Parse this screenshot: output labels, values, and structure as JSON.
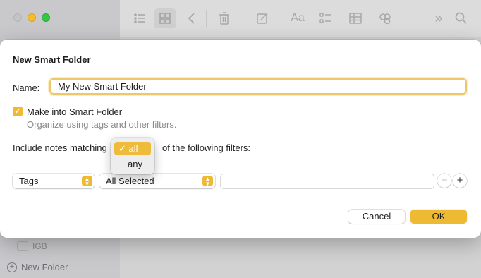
{
  "background": {
    "sidebar_item_label": "IGB",
    "new_folder_label": "New Folder",
    "toolbar_icons": [
      "list-icon",
      "grid-icon",
      "back-icon",
      "trash-icon",
      "compose-icon",
      "font-icon",
      "checklist-icon",
      "table-icon",
      "share-icon",
      "more-icon",
      "search-icon"
    ],
    "toolbar_glyphs": {
      "font": "Aa",
      "more": "»"
    }
  },
  "dialog": {
    "title": "New Smart Folder",
    "name_label": "Name:",
    "name_value": "My New Smart Folder",
    "make_smart_label": "Make into Smart Folder",
    "make_smart_checked": true,
    "make_smart_sublabel": "Organize using tags and other filters.",
    "include_prefix": "Include notes matching",
    "include_suffix": "of the following filters:",
    "match_menu": {
      "selected": "all",
      "options": [
        "all",
        "any"
      ]
    },
    "filter": {
      "field_label": "Tags",
      "value_label": "All Selected",
      "text_value": ""
    },
    "cancel_label": "Cancel",
    "ok_label": "OK"
  },
  "colors": {
    "accent": "#efb934",
    "focus_ring": "#efc866"
  }
}
